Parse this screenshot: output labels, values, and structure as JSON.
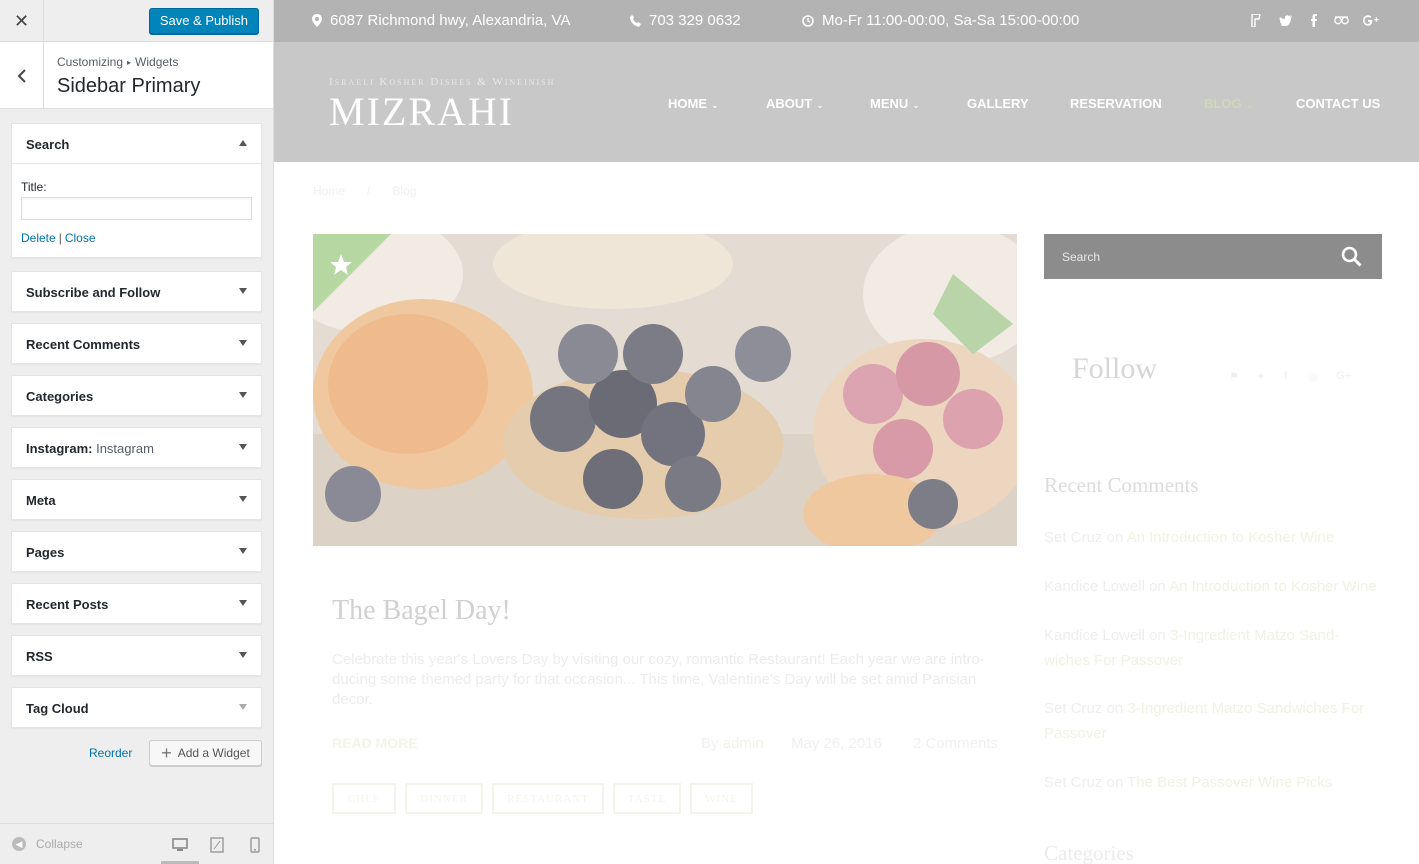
{
  "customizer": {
    "close_icon": "close-icon",
    "publish_label": "Save & Publish",
    "breadcrumb": {
      "root": "Customizing",
      "current": "Widgets"
    },
    "section_title": "Sidebar Primary",
    "search_widget": {
      "title": "Search",
      "field_label": "Title:",
      "field_value": "",
      "delete_label": "Delete",
      "separator": "|",
      "close_label": "Close"
    },
    "widgets": [
      {
        "title": "Subscribe and Follow",
        "sub": ""
      },
      {
        "title": "Recent Comments",
        "sub": ""
      },
      {
        "title": "Categories",
        "sub": ""
      },
      {
        "title": "Instagram:",
        "sub": "Instagram"
      },
      {
        "title": "Meta",
        "sub": ""
      },
      {
        "title": "Pages",
        "sub": ""
      },
      {
        "title": "Recent Posts",
        "sub": ""
      },
      {
        "title": "RSS",
        "sub": ""
      },
      {
        "title": "Tag Cloud",
        "sub": ""
      }
    ],
    "reorder_label": "Reorder",
    "add_widget_label": "Add a Widget",
    "collapse_label": "Collapse",
    "devices": [
      "desktop-icon",
      "tablet-icon",
      "mobile-icon"
    ],
    "accent_color": "#0085ba"
  },
  "site": {
    "topbar": {
      "address": "6087 Richmond hwy, Alexandria, VA",
      "phone": "703 329 0632",
      "hours": "Mo-Fr 11:00-00:00, Sa-Sa 15:00-00:00",
      "social_icons": [
        "foursquare-icon",
        "twitter-icon",
        "facebook-icon",
        "tripadvisor-icon",
        "google-plus-icon"
      ]
    },
    "tagline": "Israeli Kosher Dishes & Wineinish",
    "logo": "MIZRAHI",
    "nav": [
      {
        "label": "HOME",
        "dropdown": true,
        "active": false
      },
      {
        "label": "ABOUT",
        "dropdown": true,
        "active": false
      },
      {
        "label": "MENU",
        "dropdown": true,
        "active": false
      },
      {
        "label": "GALLERY",
        "dropdown": false,
        "active": false
      },
      {
        "label": "RESERVATION",
        "dropdown": false,
        "active": false
      },
      {
        "label": "BLOG",
        "dropdown": true,
        "active": true
      },
      {
        "label": "CONTACT US",
        "dropdown": false,
        "active": false
      }
    ],
    "breadcrumbs": {
      "home": "Home",
      "separator": "/",
      "current": "Blog"
    },
    "post": {
      "title": "The Bagel Day!",
      "excerpt": "Celebrate this year's Lovers Day by visiting our cozy, romantic Restaurant! Each year we are intro-ducing some themed party for that occasion... This time, Valentine's Day will be set amid Parisian decor.",
      "read_more": "READ MORE",
      "author_prefix": "By",
      "author": "admin",
      "date": "May 26, 2016",
      "comments": "2 Comments",
      "tags": [
        "CHEF",
        "DINNER",
        "RESTAURANT",
        "TASTE",
        "WINE"
      ]
    },
    "sidebar": {
      "search_placeholder": "Search",
      "follow_title": "Follow",
      "recent_comments_title": "Recent Comments",
      "recent_comments": [
        {
          "author": "Set Cruz",
          "on": "on",
          "post": "An Introduction to Kosher Wine"
        },
        {
          "author": "Kandice Lowell",
          "on": "on",
          "post": "An Introduction to Kosher Wine"
        },
        {
          "author": "Kandice Lowell",
          "on": "on",
          "post": "3-Ingredient Matzo Sand-wiches For Passover"
        },
        {
          "author": "Set Cruz",
          "on": "on",
          "post": "3-Ingredient Matzo Sandwiches For Passover"
        },
        {
          "author": "Set Cruz",
          "on": "on",
          "post": "The Best Passover Wine Picks"
        }
      ],
      "categories_title": "Categories"
    }
  }
}
